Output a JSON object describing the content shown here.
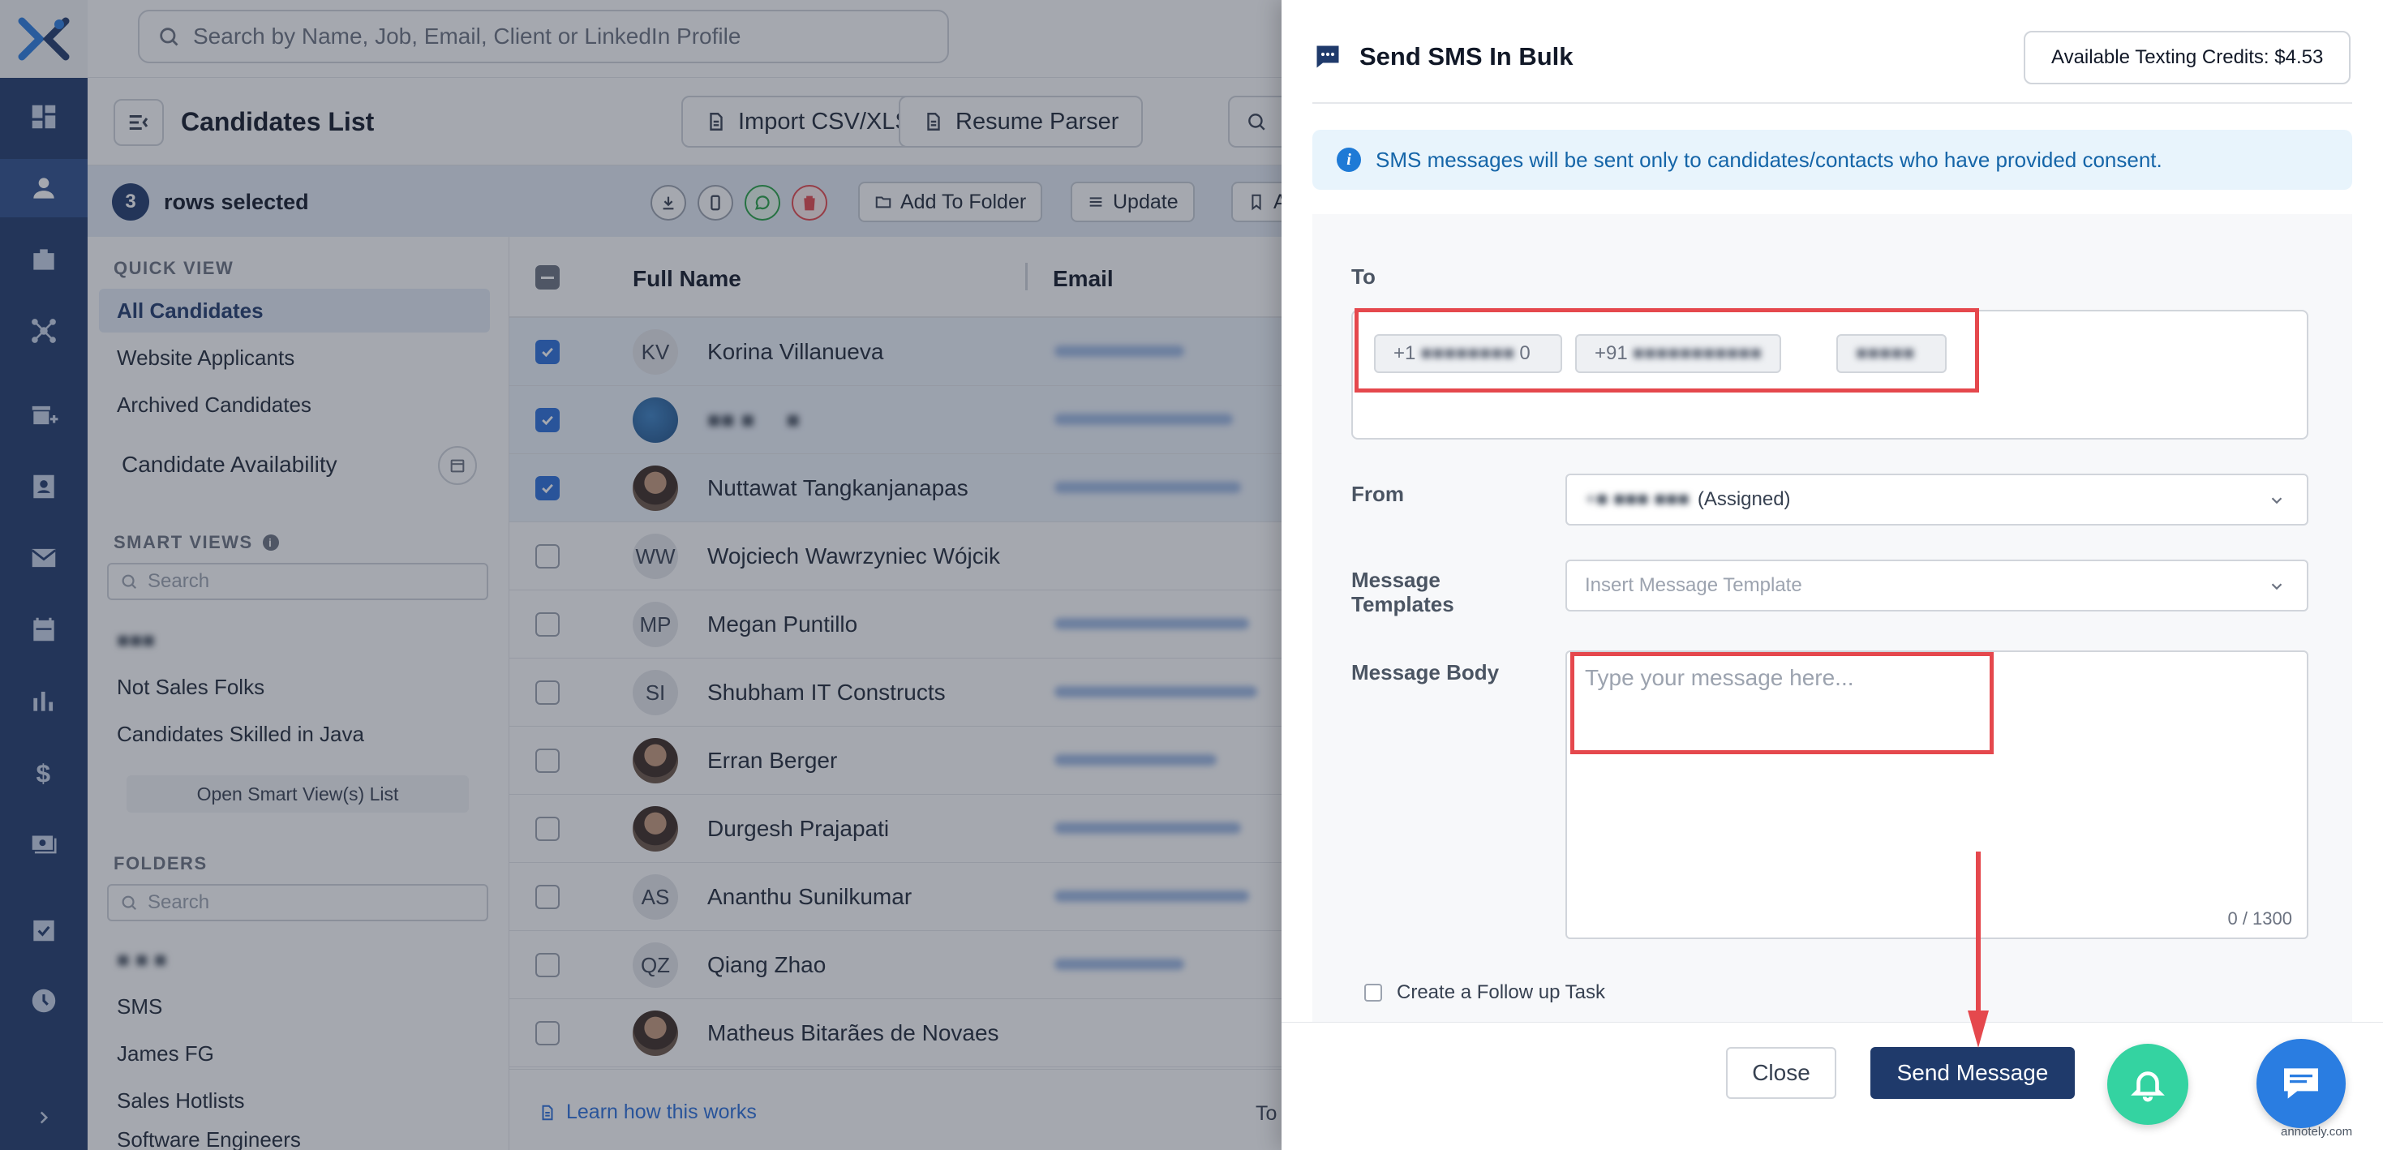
{
  "top_search": {
    "placeholder": "Search by Name, Job, Email, Client or LinkedIn Profile"
  },
  "page": {
    "title": "Candidates List",
    "buttons": [
      "Import CSV/XLS",
      "Resume Parser"
    ]
  },
  "selection": {
    "count": "3",
    "label": "rows selected",
    "actions": [
      "Add To Folder",
      "Update",
      "A"
    ]
  },
  "sidebar": {
    "quick_view_heading": "QUICK VIEW",
    "quick_view": [
      "All Candidates",
      "Website Applicants",
      "Archived Candidates"
    ],
    "availability": "Candidate Availability",
    "smart_views_heading": "SMART VIEWS",
    "search_placeholder": "Search",
    "smart_views": [
      "Not Sales Folks",
      "Candidates Skilled in Java"
    ],
    "open_smart_views": "Open Smart View(s) List",
    "folders_heading": "FOLDERS",
    "folders": [
      "SMS",
      "James FG",
      "Sales Hotlists",
      "Software Engineers"
    ]
  },
  "table": {
    "columns": [
      "Full Name",
      "Email"
    ],
    "rows": [
      {
        "initials": "KV",
        "name": "Korina Villanueva",
        "checked": true
      },
      {
        "initials": "",
        "name": "",
        "checked": true
      },
      {
        "initials": "",
        "name": "Nuttawat Tangkanjanapas",
        "checked": true
      },
      {
        "initials": "WW",
        "name": "Wojciech Wawrzyniec Wójcik",
        "checked": false
      },
      {
        "initials": "MP",
        "name": "Megan Puntillo",
        "checked": false
      },
      {
        "initials": "SI",
        "name": "Shubham IT Constructs",
        "checked": false
      },
      {
        "initials": "",
        "name": "Erran Berger",
        "checked": false
      },
      {
        "initials": "",
        "name": "Durgesh Prajapati",
        "checked": false
      },
      {
        "initials": "AS",
        "name": "Ananthu Sunilkumar",
        "checked": false
      },
      {
        "initials": "QZ",
        "name": "Qiang Zhao",
        "checked": false
      },
      {
        "initials": "",
        "name": "Matheus Bitarães de Novaes",
        "checked": false
      }
    ],
    "footer_link": "Learn how this works",
    "footer_right": "To"
  },
  "modal": {
    "title": "Send SMS In Bulk",
    "credits": "Available Texting Credits: $4.53",
    "notice": "SMS messages will be sent only to candidates/contacts who have provided consent.",
    "to_label": "To",
    "to_chips": [
      {
        "prefix": "+1",
        "suffix": "0"
      },
      {
        "prefix": "+91",
        "suffix": ""
      },
      {
        "prefix": "",
        "suffix": ""
      }
    ],
    "from_label": "From",
    "from_value": "(Assigned)",
    "templates_label": "Message Templates",
    "templates_placeholder": "Insert Message Template",
    "body_label": "Message Body",
    "body_placeholder": "Type your message here...",
    "char_count": "0 / 1300",
    "follow_up": "Create a Follow up Task",
    "close": "Close",
    "send": "Send Message",
    "watermark": "annotely.com"
  },
  "colors": {
    "rail": "#1f3a6b",
    "primary": "#1f3a6b",
    "accent_blue": "#2a6fdb",
    "annotation_red": "#e5484d",
    "bell_green": "#34d3a1"
  },
  "icons": {
    "rail": [
      "dashboard-icon",
      "person-icon",
      "briefcase-icon",
      "network-icon",
      "store-add-icon",
      "contact-card-icon",
      "mail-icon",
      "calendar-icon",
      "reports-icon",
      "dollar-icon",
      "money-icon",
      "task-calendar-icon",
      "clock-icon",
      "chevron-right-icon"
    ]
  }
}
